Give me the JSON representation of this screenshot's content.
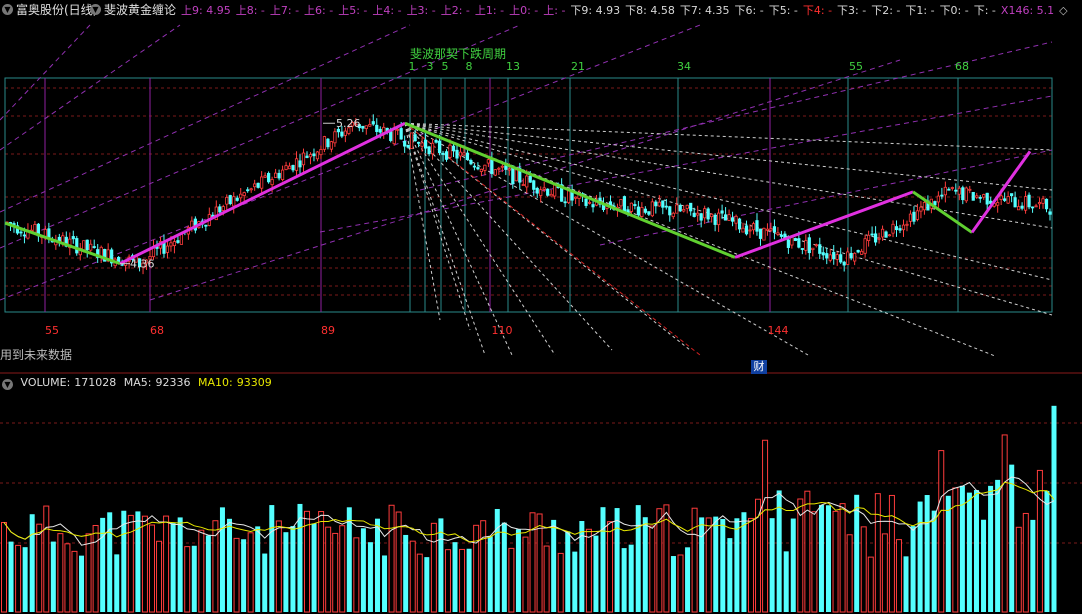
{
  "header": {
    "stock_name": "富奥股份(日线)",
    "indicator_name": "斐波黄金缠论",
    "up_levels": [
      {
        "label": "上9:",
        "value": "4.95"
      },
      {
        "label": "上8:",
        "value": "-"
      },
      {
        "label": "上7:",
        "value": "-"
      },
      {
        "label": "上6:",
        "value": "-"
      },
      {
        "label": "上5:",
        "value": "-"
      },
      {
        "label": "上4:",
        "value": "-"
      },
      {
        "label": "上3:",
        "value": "-"
      },
      {
        "label": "上2:",
        "value": "-"
      },
      {
        "label": "上1:",
        "value": "-"
      },
      {
        "label": "上0:",
        "value": "-"
      },
      {
        "label": "上:",
        "value": "-"
      }
    ],
    "down_levels": [
      {
        "label": "下9:",
        "value": "4.93"
      },
      {
        "label": "下8:",
        "value": "4.58"
      },
      {
        "label": "下7:",
        "value": "4.35"
      },
      {
        "label": "下6:",
        "value": "-"
      },
      {
        "label": "下5:",
        "value": "-"
      },
      {
        "label": "下4:",
        "value": "-"
      },
      {
        "label": "下3:",
        "value": "-"
      },
      {
        "label": "下2:",
        "value": "-"
      },
      {
        "label": "下1:",
        "value": "-"
      },
      {
        "label": "下0:",
        "value": "-"
      },
      {
        "label": "下:",
        "value": "-"
      }
    ],
    "tail": "X146: 5.1",
    "diamond_glyph": "◇",
    "colors": {
      "up": "#c040c0",
      "down": "#d8d8d8",
      "down_highlight": "#ff3030",
      "tail": "#c040c0"
    }
  },
  "main_chart": {
    "cycle_title": "斐波那契下跌周期",
    "high_label": "5.26",
    "low_label": "4.36",
    "future_data_note": "用到未来数据",
    "finance_marker": "财",
    "top_fib_numbers": [
      "1",
      "3",
      "5",
      "8",
      "13",
      "21",
      "34",
      "55",
      "68"
    ],
    "bottom_fib_numbers": [
      "55",
      "68",
      "89",
      "110",
      "144"
    ]
  },
  "volume_header": {
    "title": "VOLUME:",
    "volume": "171028",
    "ma5_label": "MA5:",
    "ma5": "92336",
    "ma10_label": "MA10:",
    "ma10": "93309"
  },
  "chart_data": [
    {
      "type": "line",
      "title": "斐波黄金缠论",
      "series": [
        {
          "values": [
            4.62,
            4.58,
            4.51,
            4.44,
            4.36,
            4.47,
            4.62,
            4.7,
            4.85,
            5.05,
            5.26,
            5.1,
            4.95,
            4.8,
            4.7,
            4.62,
            4.52,
            4.4,
            4.55,
            4.65,
            4.82,
            4.75,
            4.7,
            5.08,
            5.12
          ]
        }
      ],
      "annotations": [
        "5.26",
        "4.36"
      ]
    },
    {
      "type": "bar",
      "title": "VOLUME",
      "series": [
        {
          "name": "VOLUME",
          "values": [
            171028
          ]
        },
        {
          "name": "MA5",
          "values": [
            92336
          ]
        },
        {
          "name": "MA10",
          "values": [
            93309
          ]
        }
      ]
    }
  ]
}
